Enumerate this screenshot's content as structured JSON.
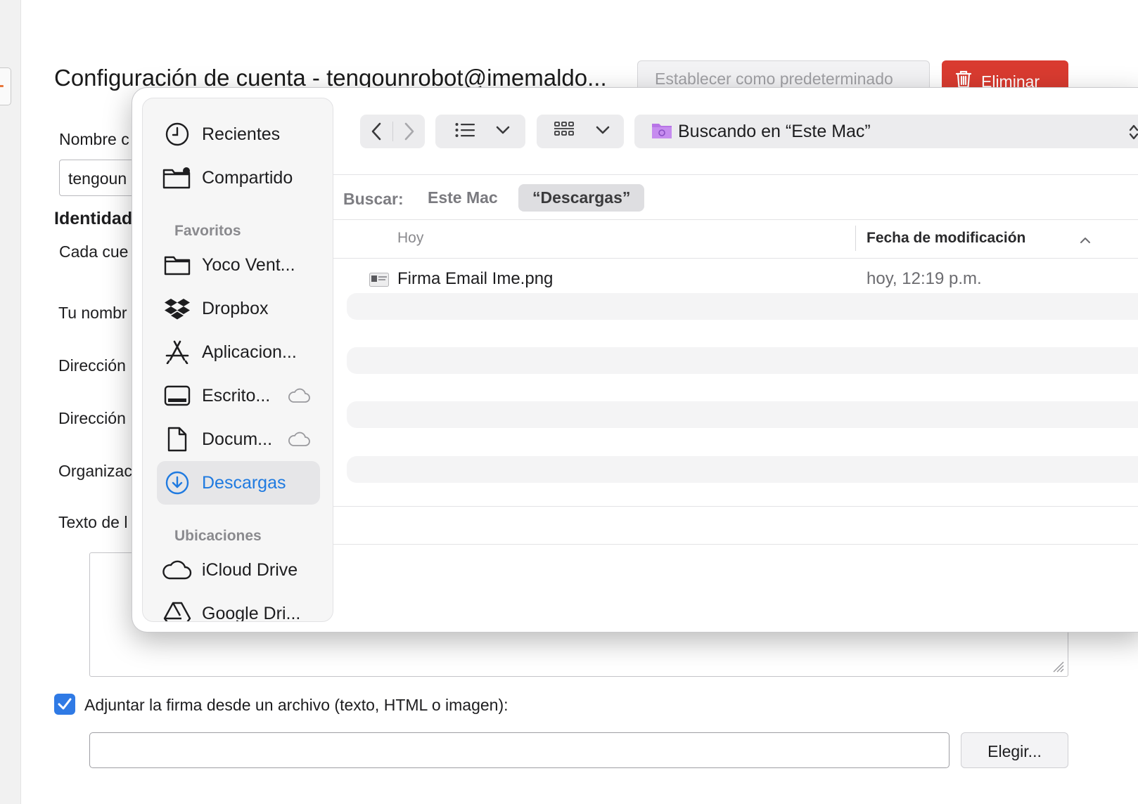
{
  "window": {
    "title": "Configuración de cuenta - tengounrobot@imemaldo...",
    "set_default_label": "Establecer como predeterminado",
    "delete_label": "Eliminar"
  },
  "form": {
    "account_name_label": "Nombre c",
    "account_name_value": "tengoun",
    "identity_heading": "Identidad",
    "identity_desc": "Cada cue",
    "your_name_label": "Tu nombr",
    "address_label_1": "Dirección",
    "address_label_2": "Dirección",
    "organization_label": "Organizac",
    "signature_text_label": "Texto de l",
    "attach_signature_label": "Adjuntar la firma desde un archivo (texto, HTML o imagen):",
    "attach_signature_checked": true,
    "file_path_value": "",
    "choose_button_label": "Elegir..."
  },
  "dialog": {
    "sidebar": {
      "top_items": [
        {
          "label": "Recientes",
          "icon": "clock-icon"
        },
        {
          "label": "Compartido",
          "icon": "shared-folder-icon"
        }
      ],
      "favorites_header": "Favoritos",
      "favorites": [
        {
          "label": "Yoco Vent...",
          "icon": "folder-icon"
        },
        {
          "label": "Dropbox",
          "icon": "dropbox-icon"
        },
        {
          "label": "Aplicacion...",
          "icon": "applications-icon"
        },
        {
          "label": "Escrito...",
          "icon": "desktop-icon",
          "cloud": true
        },
        {
          "label": "Docum...",
          "icon": "document-icon",
          "cloud": true
        },
        {
          "label": "Descargas",
          "icon": "download-icon",
          "selected": true
        }
      ],
      "locations_header": "Ubicaciones",
      "locations": [
        {
          "label": "iCloud Drive",
          "icon": "cloud-icon"
        },
        {
          "label": "Google Dri...",
          "icon": "google-drive-icon"
        }
      ]
    },
    "toolbar": {
      "search_location": "Buscando en “Este Mac”"
    },
    "search_scope": {
      "label": "Buscar:",
      "options": [
        "Este Mac",
        "“Descargas”"
      ],
      "selected": 1
    },
    "columns": {
      "group_label": "Hoy",
      "date_modified": "Fecha de modificación"
    },
    "files": [
      {
        "name": "Firma Email Ime.png",
        "date": "hoy, 12:19 p.m."
      }
    ]
  },
  "colors": {
    "accent": "#1f7ae0",
    "delete": "#d93b30",
    "checkbox": "#2f7ae5"
  }
}
